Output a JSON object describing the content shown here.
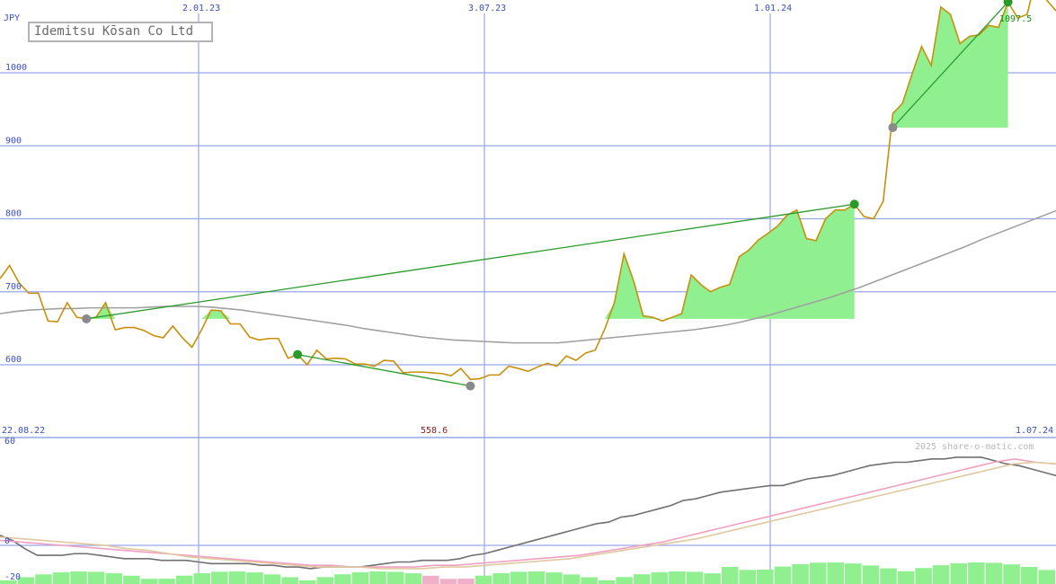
{
  "chart_data": [
    {
      "type": "line",
      "title": "Idemitsu Kōsan Co Ltd",
      "currency_label": "JPY",
      "ylim": [
        490,
        1100
      ],
      "yticks": [
        600,
        700,
        800,
        900,
        1000
      ],
      "x_date_labels": [
        "2.01.23",
        "3.07.23",
        "1.01.24"
      ],
      "range_start_label": "22.08.22",
      "range_end_label": "1.07.24",
      "min_label": "558.6",
      "max_label": "1097.5",
      "grid": true,
      "series": [
        {
          "role": "price",
          "color": "#c8900a",
          "values": [
            718,
            736,
            712,
            698,
            698,
            660,
            659,
            685,
            665,
            663,
            665,
            685,
            648,
            651,
            651,
            647,
            640,
            637,
            653,
            637,
            624,
            648,
            675,
            674,
            656,
            656,
            638,
            634,
            636,
            636,
            609,
            614,
            600,
            620,
            608,
            609,
            608,
            601,
            601,
            598,
            606,
            605,
            589,
            590,
            590,
            589,
            588,
            585,
            595,
            580,
            581,
            586,
            586,
            598,
            595,
            591,
            597,
            602,
            598,
            612,
            606,
            616,
            620,
            649,
            685,
            752,
            715,
            667,
            665,
            660,
            665,
            670,
            723,
            710,
            700,
            706,
            710,
            748,
            757,
            771,
            780,
            790,
            805,
            812,
            773,
            770,
            800,
            812,
            812,
            820,
            803,
            800,
            824,
            944,
            958,
            998,
            1036,
            1010,
            1090,
            1080,
            1040,
            1050,
            1052,
            1065,
            1062,
            1097,
            1075,
            1080,
            1135,
            1100,
            1085
          ]
        },
        {
          "role": "moving_average",
          "color": "#a0a0a0",
          "values": [
            670,
            673,
            675,
            676,
            677,
            677,
            678,
            678,
            678,
            678,
            679,
            680,
            680,
            680,
            679,
            677,
            675,
            672,
            669,
            666,
            663,
            660,
            657,
            654,
            650,
            647,
            644,
            641,
            638,
            636,
            634,
            633,
            632,
            631,
            630,
            630,
            630,
            630,
            632,
            634,
            636,
            638,
            640,
            642,
            644,
            646,
            648,
            651,
            654,
            658,
            663,
            668,
            674,
            680,
            686,
            692,
            699,
            706,
            714,
            722,
            730,
            738,
            746,
            754,
            762,
            771,
            779,
            787,
            795,
            803,
            811
          ]
        }
      ],
      "trend_markers": [
        {
          "from_value": 571,
          "to_value": 614
        },
        {
          "from_value": 663,
          "to_value": 820
        },
        {
          "from_value": 925,
          "to_value": 1097
        }
      ]
    },
    {
      "type": "line",
      "title": "",
      "ylim": [
        -20,
        60
      ],
      "yticks": [
        60,
        0,
        -20
      ],
      "grid": true,
      "series": [
        {
          "role": "oscillator",
          "color": "#707070",
          "values": [
            6,
            3,
            -2,
            -6,
            -6,
            -6,
            -5,
            -5,
            -6,
            -7,
            -8,
            -8,
            -8,
            -9,
            -9,
            -9,
            -10,
            -11,
            -11,
            -11,
            -11,
            -12,
            -12,
            -13,
            -13,
            -14,
            -13,
            -13,
            -13,
            -13,
            -12,
            -11,
            -10,
            -10,
            -9,
            -9,
            -9,
            -8,
            -6,
            -5,
            -3,
            -1,
            1,
            3,
            5,
            7,
            9,
            11,
            13,
            14,
            17,
            18,
            20,
            22,
            24,
            27,
            28,
            30,
            32,
            33,
            34,
            35,
            36,
            36,
            38,
            40,
            41,
            42,
            44,
            46,
            48,
            49,
            50,
            50,
            51,
            52,
            52,
            53,
            53,
            53,
            51,
            49,
            48,
            46,
            44,
            42
          ]
        },
        {
          "role": "signal",
          "color": "#f0a0c0",
          "values": [
            3,
            2,
            1,
            0,
            -1,
            -2,
            -3,
            -4,
            -5,
            -6,
            -7,
            -8,
            -9,
            -10,
            -11,
            -12,
            -12,
            -13,
            -13,
            -13,
            -13,
            -12,
            -12,
            -11,
            -10,
            -9,
            -8,
            -7,
            -6,
            -4,
            -2,
            0,
            2,
            5,
            8,
            11,
            14,
            17,
            20,
            23,
            26,
            29,
            32,
            35,
            38,
            41,
            44,
            47,
            50,
            52,
            50,
            49
          ]
        },
        {
          "role": "signal_slow",
          "color": "#e0c8a0",
          "values": [
            5,
            4,
            3,
            2,
            1,
            0,
            -2,
            -3,
            -5,
            -7,
            -8,
            -9,
            -10,
            -11,
            -12,
            -13,
            -13,
            -13,
            -14,
            -14,
            -14,
            -13,
            -13,
            -12,
            -11,
            -10,
            -9,
            -8,
            -6,
            -4,
            -2,
            0,
            2,
            4,
            7,
            10,
            13,
            16,
            19,
            22,
            25,
            28,
            31,
            34,
            37,
            40,
            43,
            46,
            49,
            50,
            49
          ]
        }
      ]
    }
  ],
  "watermark": "2025 share-o-matic.com"
}
